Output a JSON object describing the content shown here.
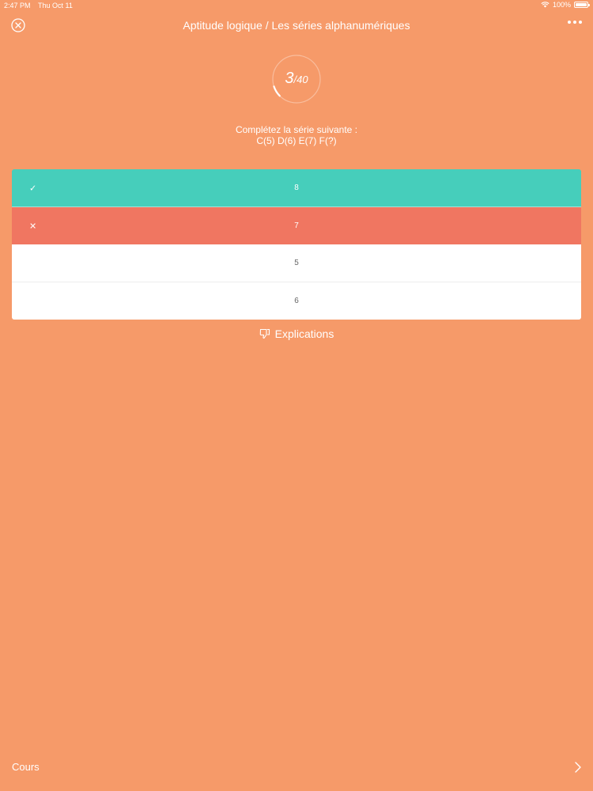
{
  "status": {
    "time": "2:47 PM",
    "date": "Thu Oct 11",
    "battery": "100%"
  },
  "nav": {
    "title": "Aptitude logique / Les séries alphanumériques",
    "close_icon": "close-circle-icon",
    "more_icon": "more-horizontal-icon"
  },
  "progress": {
    "current": "3",
    "total": "/40",
    "fraction": 0.075
  },
  "question": {
    "prompt": "Complétez la série suivante :",
    "series": "C(5) D(6) E(7) F(?)"
  },
  "answers": [
    {
      "label": "8",
      "state": "correct",
      "mark": "✓"
    },
    {
      "label": "7",
      "state": "wrong",
      "mark": "✕"
    },
    {
      "label": "5",
      "state": "neutral"
    },
    {
      "label": "6",
      "state": "neutral"
    }
  ],
  "explications": {
    "label": "Explications",
    "icon": "thumbs-down-icon"
  },
  "footer": {
    "cours_label": "Cours",
    "chevron_icon": "chevron-right-icon"
  },
  "colors": {
    "background": "#F69A69",
    "correct": "#46CEBB",
    "wrong": "#F07661"
  }
}
